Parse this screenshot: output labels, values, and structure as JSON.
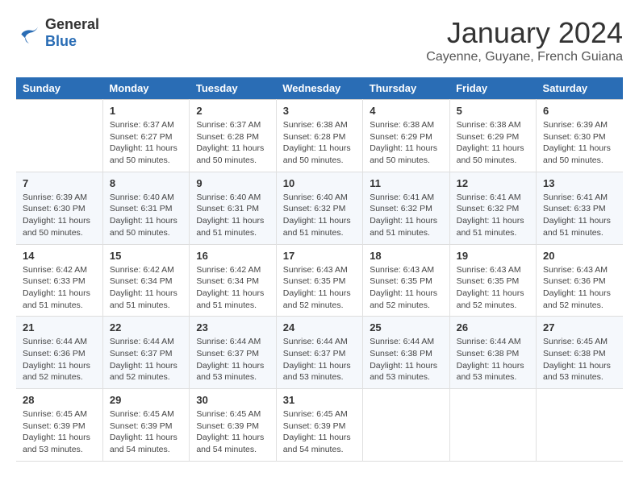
{
  "logo": {
    "line1": "General",
    "line2": "Blue"
  },
  "title": "January 2024",
  "location": "Cayenne, Guyane, French Guiana",
  "weekdays": [
    "Sunday",
    "Monday",
    "Tuesday",
    "Wednesday",
    "Thursday",
    "Friday",
    "Saturday"
  ],
  "weeks": [
    [
      {
        "day": "",
        "sunrise": "",
        "sunset": "",
        "daylight": ""
      },
      {
        "day": "1",
        "sunrise": "Sunrise: 6:37 AM",
        "sunset": "Sunset: 6:27 PM",
        "daylight": "Daylight: 11 hours and 50 minutes."
      },
      {
        "day": "2",
        "sunrise": "Sunrise: 6:37 AM",
        "sunset": "Sunset: 6:28 PM",
        "daylight": "Daylight: 11 hours and 50 minutes."
      },
      {
        "day": "3",
        "sunrise": "Sunrise: 6:38 AM",
        "sunset": "Sunset: 6:28 PM",
        "daylight": "Daylight: 11 hours and 50 minutes."
      },
      {
        "day": "4",
        "sunrise": "Sunrise: 6:38 AM",
        "sunset": "Sunset: 6:29 PM",
        "daylight": "Daylight: 11 hours and 50 minutes."
      },
      {
        "day": "5",
        "sunrise": "Sunrise: 6:38 AM",
        "sunset": "Sunset: 6:29 PM",
        "daylight": "Daylight: 11 hours and 50 minutes."
      },
      {
        "day": "6",
        "sunrise": "Sunrise: 6:39 AM",
        "sunset": "Sunset: 6:30 PM",
        "daylight": "Daylight: 11 hours and 50 minutes."
      }
    ],
    [
      {
        "day": "7",
        "sunrise": "Sunrise: 6:39 AM",
        "sunset": "Sunset: 6:30 PM",
        "daylight": "Daylight: 11 hours and 50 minutes."
      },
      {
        "day": "8",
        "sunrise": "Sunrise: 6:40 AM",
        "sunset": "Sunset: 6:31 PM",
        "daylight": "Daylight: 11 hours and 50 minutes."
      },
      {
        "day": "9",
        "sunrise": "Sunrise: 6:40 AM",
        "sunset": "Sunset: 6:31 PM",
        "daylight": "Daylight: 11 hours and 51 minutes."
      },
      {
        "day": "10",
        "sunrise": "Sunrise: 6:40 AM",
        "sunset": "Sunset: 6:32 PM",
        "daylight": "Daylight: 11 hours and 51 minutes."
      },
      {
        "day": "11",
        "sunrise": "Sunrise: 6:41 AM",
        "sunset": "Sunset: 6:32 PM",
        "daylight": "Daylight: 11 hours and 51 minutes."
      },
      {
        "day": "12",
        "sunrise": "Sunrise: 6:41 AM",
        "sunset": "Sunset: 6:32 PM",
        "daylight": "Daylight: 11 hours and 51 minutes."
      },
      {
        "day": "13",
        "sunrise": "Sunrise: 6:41 AM",
        "sunset": "Sunset: 6:33 PM",
        "daylight": "Daylight: 11 hours and 51 minutes."
      }
    ],
    [
      {
        "day": "14",
        "sunrise": "Sunrise: 6:42 AM",
        "sunset": "Sunset: 6:33 PM",
        "daylight": "Daylight: 11 hours and 51 minutes."
      },
      {
        "day": "15",
        "sunrise": "Sunrise: 6:42 AM",
        "sunset": "Sunset: 6:34 PM",
        "daylight": "Daylight: 11 hours and 51 minutes."
      },
      {
        "day": "16",
        "sunrise": "Sunrise: 6:42 AM",
        "sunset": "Sunset: 6:34 PM",
        "daylight": "Daylight: 11 hours and 51 minutes."
      },
      {
        "day": "17",
        "sunrise": "Sunrise: 6:43 AM",
        "sunset": "Sunset: 6:35 PM",
        "daylight": "Daylight: 11 hours and 52 minutes."
      },
      {
        "day": "18",
        "sunrise": "Sunrise: 6:43 AM",
        "sunset": "Sunset: 6:35 PM",
        "daylight": "Daylight: 11 hours and 52 minutes."
      },
      {
        "day": "19",
        "sunrise": "Sunrise: 6:43 AM",
        "sunset": "Sunset: 6:35 PM",
        "daylight": "Daylight: 11 hours and 52 minutes."
      },
      {
        "day": "20",
        "sunrise": "Sunrise: 6:43 AM",
        "sunset": "Sunset: 6:36 PM",
        "daylight": "Daylight: 11 hours and 52 minutes."
      }
    ],
    [
      {
        "day": "21",
        "sunrise": "Sunrise: 6:44 AM",
        "sunset": "Sunset: 6:36 PM",
        "daylight": "Daylight: 11 hours and 52 minutes."
      },
      {
        "day": "22",
        "sunrise": "Sunrise: 6:44 AM",
        "sunset": "Sunset: 6:37 PM",
        "daylight": "Daylight: 11 hours and 52 minutes."
      },
      {
        "day": "23",
        "sunrise": "Sunrise: 6:44 AM",
        "sunset": "Sunset: 6:37 PM",
        "daylight": "Daylight: 11 hours and 53 minutes."
      },
      {
        "day": "24",
        "sunrise": "Sunrise: 6:44 AM",
        "sunset": "Sunset: 6:37 PM",
        "daylight": "Daylight: 11 hours and 53 minutes."
      },
      {
        "day": "25",
        "sunrise": "Sunrise: 6:44 AM",
        "sunset": "Sunset: 6:38 PM",
        "daylight": "Daylight: 11 hours and 53 minutes."
      },
      {
        "day": "26",
        "sunrise": "Sunrise: 6:44 AM",
        "sunset": "Sunset: 6:38 PM",
        "daylight": "Daylight: 11 hours and 53 minutes."
      },
      {
        "day": "27",
        "sunrise": "Sunrise: 6:45 AM",
        "sunset": "Sunset: 6:38 PM",
        "daylight": "Daylight: 11 hours and 53 minutes."
      }
    ],
    [
      {
        "day": "28",
        "sunrise": "Sunrise: 6:45 AM",
        "sunset": "Sunset: 6:39 PM",
        "daylight": "Daylight: 11 hours and 53 minutes."
      },
      {
        "day": "29",
        "sunrise": "Sunrise: 6:45 AM",
        "sunset": "Sunset: 6:39 PM",
        "daylight": "Daylight: 11 hours and 54 minutes."
      },
      {
        "day": "30",
        "sunrise": "Sunrise: 6:45 AM",
        "sunset": "Sunset: 6:39 PM",
        "daylight": "Daylight: 11 hours and 54 minutes."
      },
      {
        "day": "31",
        "sunrise": "Sunrise: 6:45 AM",
        "sunset": "Sunset: 6:39 PM",
        "daylight": "Daylight: 11 hours and 54 minutes."
      },
      {
        "day": "",
        "sunrise": "",
        "sunset": "",
        "daylight": ""
      },
      {
        "day": "",
        "sunrise": "",
        "sunset": "",
        "daylight": ""
      },
      {
        "day": "",
        "sunrise": "",
        "sunset": "",
        "daylight": ""
      }
    ]
  ]
}
